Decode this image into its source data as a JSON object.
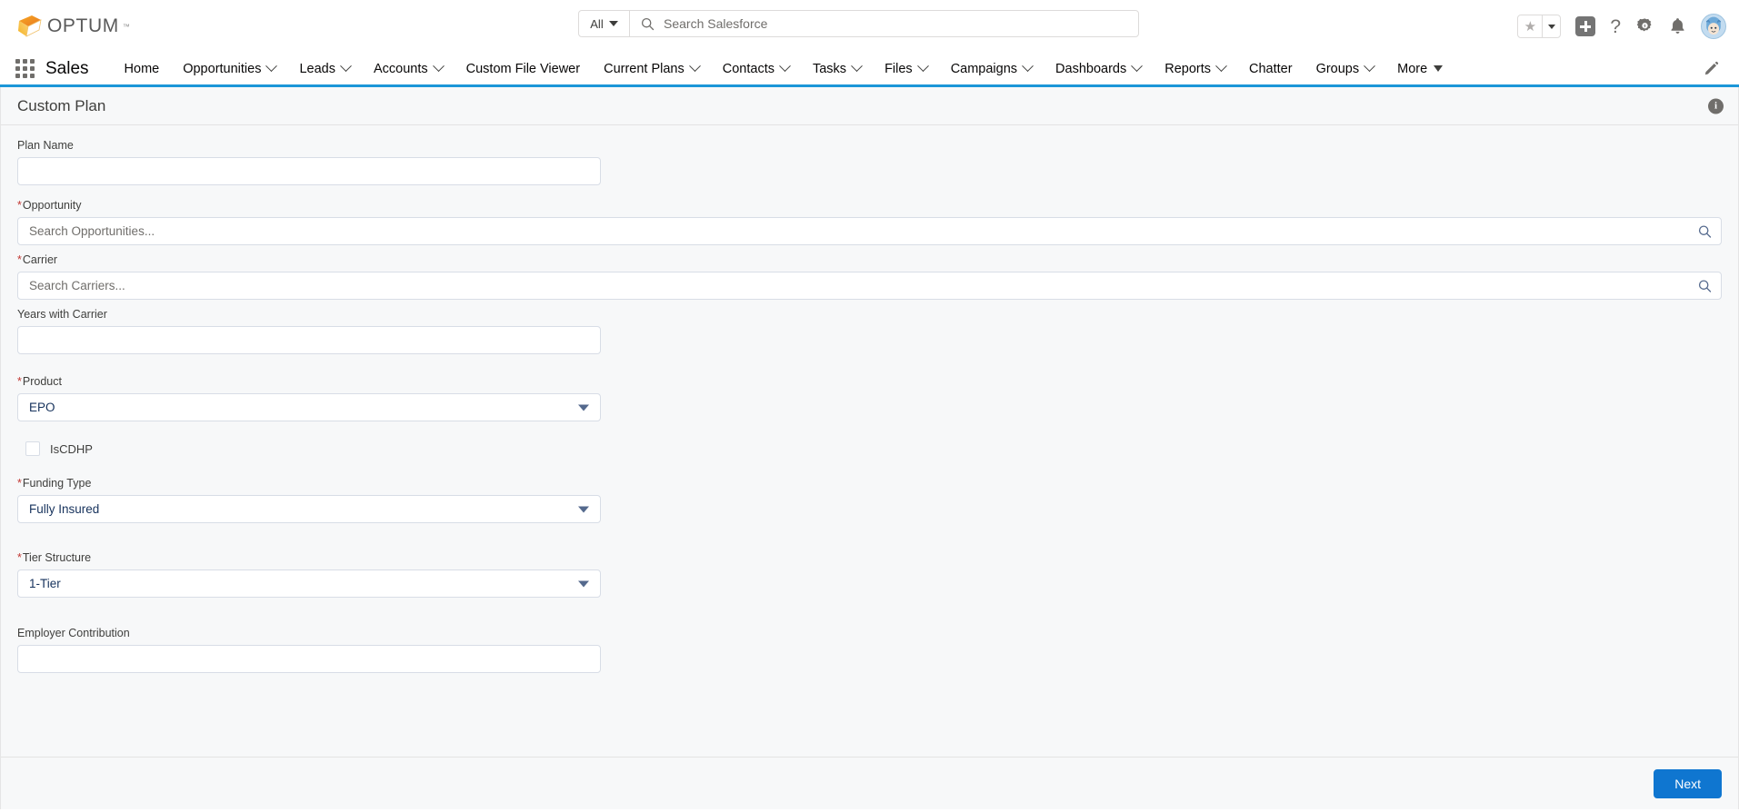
{
  "brand": {
    "logo_text": "OPTUM",
    "logo_tm": "™",
    "logo_colors": {
      "orange": "#e87722",
      "yellow": "#f5b323",
      "text": "#5a5a5a"
    }
  },
  "search": {
    "scope_label": "All",
    "placeholder": "Search Salesforce",
    "icon": "search-icon"
  },
  "header_actions": {
    "favorites_icon": "star-icon",
    "favorites_caret_icon": "chevron-down-icon",
    "add_icon": "plus-icon",
    "help_icon": "question-mark-icon",
    "setup_icon": "gear-icon",
    "notifications_icon": "bell-icon",
    "avatar_icon": "user-avatar"
  },
  "nav": {
    "app_launcher_icon": "app-launcher-waffle-icon",
    "app_name": "Sales",
    "edit_icon": "pencil-icon",
    "items": [
      {
        "label": "Home",
        "has_menu": false
      },
      {
        "label": "Opportunities",
        "has_menu": true
      },
      {
        "label": "Leads",
        "has_menu": true
      },
      {
        "label": "Accounts",
        "has_menu": true
      },
      {
        "label": "Custom File Viewer",
        "has_menu": false
      },
      {
        "label": "Current Plans",
        "has_menu": true
      },
      {
        "label": "Contacts",
        "has_menu": true
      },
      {
        "label": "Tasks",
        "has_menu": true
      },
      {
        "label": "Files",
        "has_menu": true
      },
      {
        "label": "Campaigns",
        "has_menu": true
      },
      {
        "label": "Dashboards",
        "has_menu": true
      },
      {
        "label": "Reports",
        "has_menu": true
      },
      {
        "label": "Chatter",
        "has_menu": false
      },
      {
        "label": "Groups",
        "has_menu": true
      },
      {
        "label": "More",
        "has_menu": true,
        "solid_caret": true
      }
    ]
  },
  "card": {
    "title": "Custom Plan",
    "info_icon": "info-icon",
    "info_glyph": "i",
    "accent_color": "#1b96d8"
  },
  "form": {
    "plan_name": {
      "label": "Plan Name",
      "required": false,
      "value": "",
      "placeholder": ""
    },
    "opportunity": {
      "label": "Opportunity",
      "required": true,
      "value": "",
      "placeholder": "Search Opportunities...",
      "lookup_icon": "search-icon"
    },
    "carrier": {
      "label": "Carrier",
      "required": true,
      "value": "",
      "placeholder": "Search Carriers...",
      "lookup_icon": "search-icon"
    },
    "years_with_carrier": {
      "label": "Years with Carrier",
      "required": false,
      "value": "",
      "placeholder": ""
    },
    "product": {
      "label": "Product",
      "required": true,
      "value": "EPO",
      "caret_icon": "chevron-down-icon"
    },
    "is_cdhp": {
      "label": "IsCDHP",
      "checked": false
    },
    "funding_type": {
      "label": "Funding Type",
      "required": true,
      "value": "Fully Insured",
      "caret_icon": "chevron-down-icon"
    },
    "tier_structure": {
      "label": "Tier Structure",
      "required": true,
      "value": "1-Tier",
      "caret_icon": "chevron-down-icon"
    },
    "employer_contribution": {
      "label": "Employer Contribution",
      "required": false,
      "value": "",
      "placeholder": ""
    }
  },
  "footer": {
    "next_label": "Next",
    "next_color": "#0f76d0"
  }
}
